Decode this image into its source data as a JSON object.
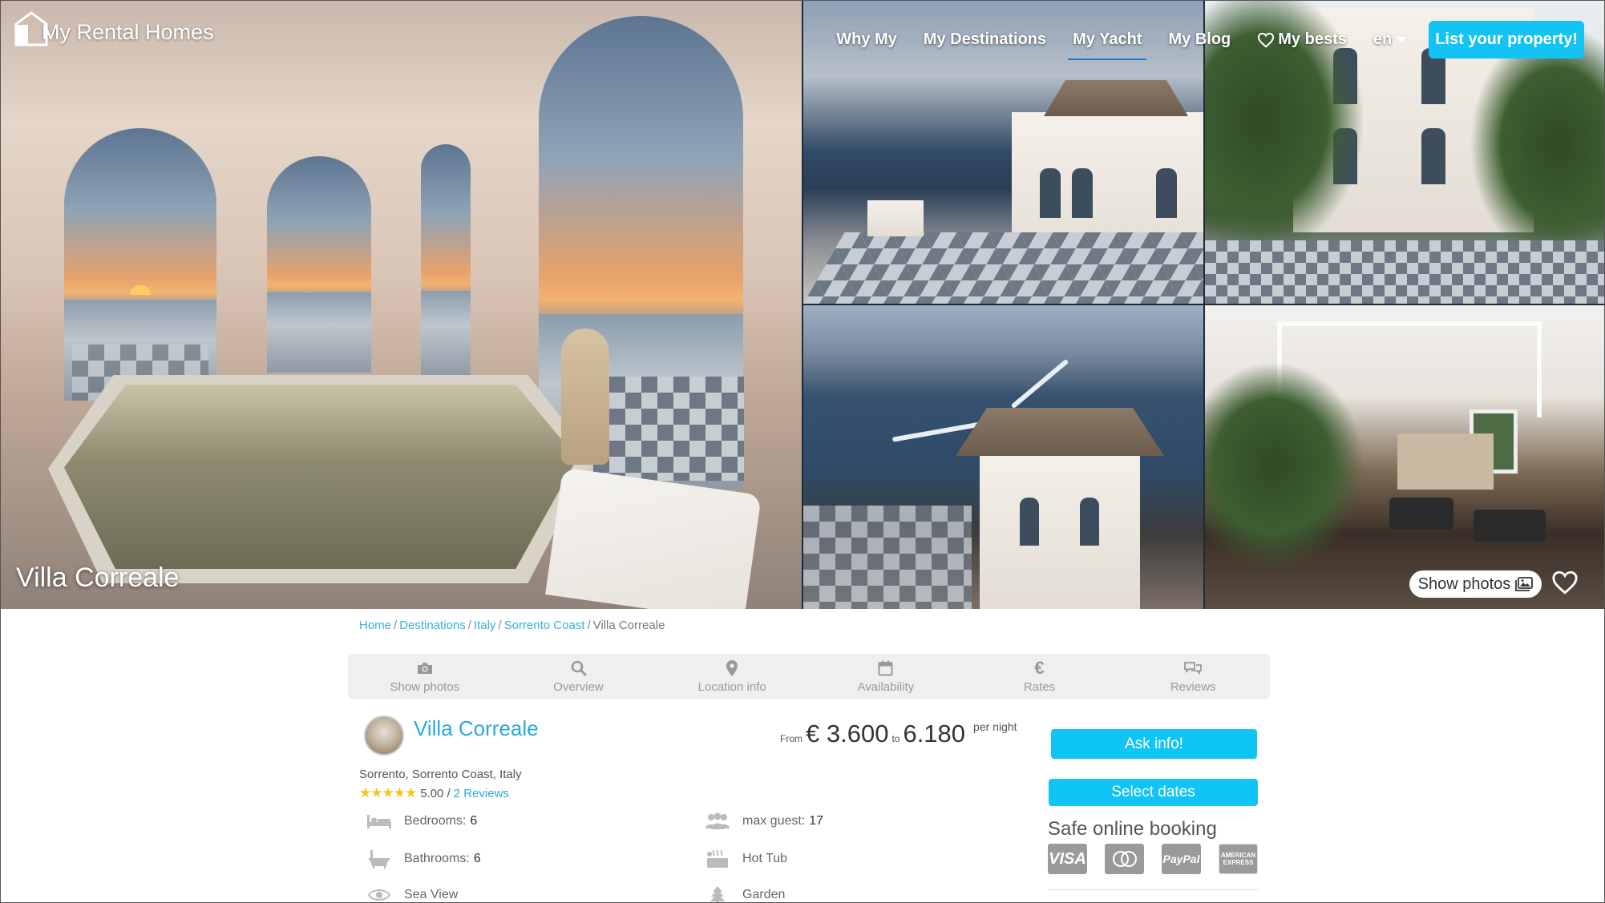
{
  "brand": {
    "name": "My Rental Homes"
  },
  "nav": {
    "items": [
      {
        "label": "Why My",
        "active": false
      },
      {
        "label": "My Destinations",
        "active": false
      },
      {
        "label": "My Yacht",
        "active": true
      },
      {
        "label": "My Blog",
        "active": false
      }
    ],
    "bests": "My bests",
    "language": "en",
    "cta": "List your property!"
  },
  "hero": {
    "title": "Villa Correale",
    "show_photos": "Show photos"
  },
  "breadcrumb": [
    {
      "label": "Home",
      "link": true
    },
    {
      "label": "Destinations",
      "link": true
    },
    {
      "label": "Italy",
      "link": true
    },
    {
      "label": "Sorrento Coast",
      "link": true
    },
    {
      "label": "Villa Correale",
      "link": false
    }
  ],
  "tabs": [
    {
      "label": "Show photos",
      "icon": "camera-icon"
    },
    {
      "label": "Overview",
      "icon": "search-icon"
    },
    {
      "label": "Location info",
      "icon": "map-pin-icon"
    },
    {
      "label": "Availability",
      "icon": "calendar-icon"
    },
    {
      "label": "Rates",
      "icon": "euro-icon"
    },
    {
      "label": "Reviews",
      "icon": "chat-icon"
    }
  ],
  "property": {
    "name": "Villa Correale",
    "location": "Sorrento, Sorrento Coast, Italy",
    "stars": "★★★★★",
    "rating": "5.00 /",
    "reviews_link": "2 Reviews",
    "price": {
      "from_label": "From",
      "from": "€ 3.600",
      "to_label": "to",
      "to": "6.180",
      "unit": "per night"
    },
    "features": {
      "bedrooms_label": "Bedrooms:",
      "bedrooms": "6",
      "bathrooms_label": "Bathrooms:",
      "bathrooms": "6",
      "sea_view": "Sea View",
      "max_guest_label": "max guest:",
      "max_guest": "17",
      "hot_tub": "Hot Tub",
      "garden": "Garden"
    }
  },
  "booking": {
    "ask_info": "Ask info!",
    "select_dates": "Select dates",
    "safe_title": "Safe online booking",
    "cards": [
      "VISA",
      "MasterCard",
      "PayPal",
      "AMERICAN EXPRESS"
    ]
  },
  "colors": {
    "accent": "#10c4f5",
    "link": "#2aa8dc",
    "star": "#f5c518"
  }
}
